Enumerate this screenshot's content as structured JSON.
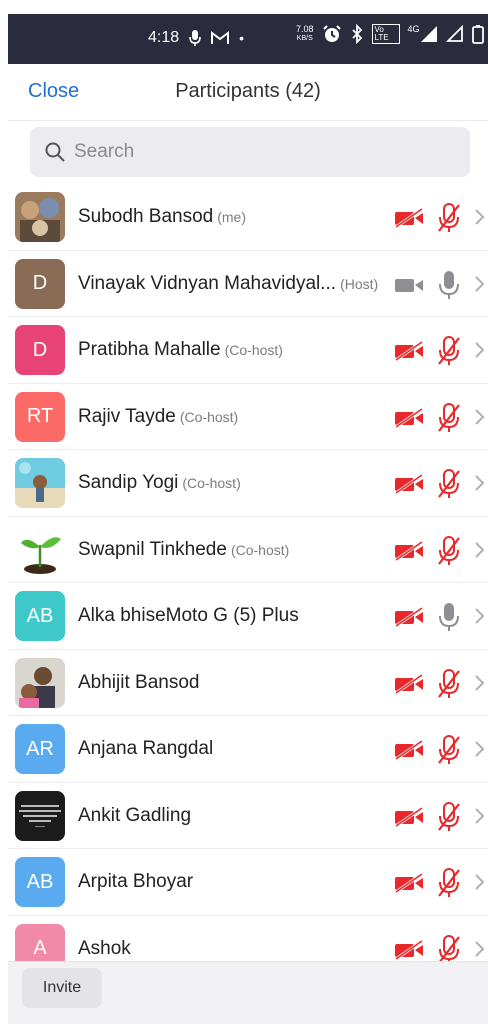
{
  "status_bar": {
    "time": "4:18",
    "net_speed_value": "7.08",
    "net_speed_unit": "KB/S",
    "volte": "Vo LTE",
    "network": "4G",
    "icons": [
      "mic-icon",
      "gmail-icon",
      "alarm-icon",
      "bluetooth-icon",
      "volte-icon",
      "signal-icon",
      "battery-icon"
    ]
  },
  "header": {
    "close_label": "Close",
    "title": "Participants (42)"
  },
  "search": {
    "placeholder": "Search"
  },
  "participants": [
    {
      "name": "Subodh Bansod",
      "role": "(me)",
      "avatar": "photo",
      "photo": "deity",
      "cam": "off",
      "mic": "muted"
    },
    {
      "name": "Vinayak Vidnyan Mahavidyal...",
      "role": "(Host)",
      "avatar": "D",
      "color": "#8a6b56",
      "cam": "on",
      "mic": "on"
    },
    {
      "name": "Pratibha Mahalle",
      "role": "(Co-host)",
      "avatar": "D",
      "color": "#e84377",
      "cam": "off",
      "mic": "muted"
    },
    {
      "name": "Rajiv Tayde",
      "role": "(Co-host)",
      "avatar": "RT",
      "color": "#fb6a66",
      "cam": "off",
      "mic": "muted"
    },
    {
      "name": "Sandip Yogi",
      "role": "(Co-host)",
      "avatar": "photo",
      "photo": "beach",
      "cam": "off",
      "mic": "muted"
    },
    {
      "name": "Swapnil Tinkhede",
      "role": "(Co-host)",
      "avatar": "photo",
      "photo": "sprout",
      "cam": "off",
      "mic": "muted"
    },
    {
      "name": "Alka bhiseMoto G (5) Plus",
      "role": "",
      "avatar": "AB",
      "color": "#3fc8c9",
      "cam": "off",
      "mic": "on"
    },
    {
      "name": "Abhijit Bansod",
      "role": "",
      "avatar": "photo",
      "photo": "selfie",
      "cam": "off",
      "mic": "muted"
    },
    {
      "name": "Anjana Rangdal",
      "role": "",
      "avatar": "AR",
      "color": "#5aaaf0",
      "cam": "off",
      "mic": "muted"
    },
    {
      "name": "Ankit Gadling",
      "role": "",
      "avatar": "photo",
      "photo": "quote",
      "cam": "off",
      "mic": "muted"
    },
    {
      "name": "Arpita Bhoyar",
      "role": "",
      "avatar": "AB",
      "color": "#5aaaf0",
      "cam": "off",
      "mic": "muted"
    },
    {
      "name": "Ashok",
      "role": "",
      "avatar": "A",
      "color": "#f08aa8",
      "cam": "off",
      "mic": "muted"
    }
  ],
  "footer": {
    "invite_label": "Invite"
  },
  "colors": {
    "accent": "#1f70d2",
    "muted_red": "#e8282b",
    "grey_icon": "#8e8e93"
  }
}
